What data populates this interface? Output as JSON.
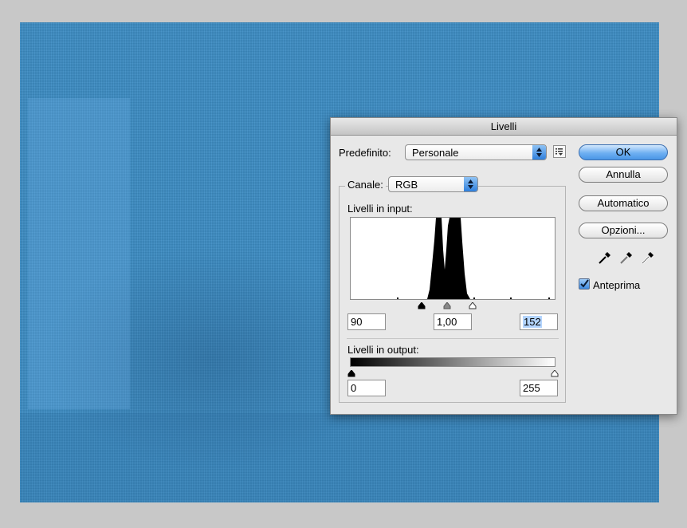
{
  "dialog": {
    "title": "Livelli",
    "preset": {
      "label": "Predefinito:",
      "value": "Personale"
    },
    "channel": {
      "label": "Canale:",
      "value": "RGB"
    },
    "input_levels": {
      "label": "Livelli in input:",
      "black": "90",
      "gamma": "1,00",
      "white": "152"
    },
    "output_levels": {
      "label": "Livelli in output:",
      "black": "0",
      "white": "255"
    },
    "buttons": {
      "ok": "OK",
      "cancel": "Annulla",
      "auto": "Automatico",
      "options": "Opzioni..."
    },
    "preview": {
      "label": "Anteprima",
      "checked": true
    },
    "icons": [
      "preset-menu-icon",
      "black-eyedropper-icon",
      "gray-eyedropper-icon",
      "white-eyedropper-icon"
    ]
  },
  "colors": {
    "canvas_blue": "#3d8dc4",
    "accent_blue": "#4a96e6"
  }
}
